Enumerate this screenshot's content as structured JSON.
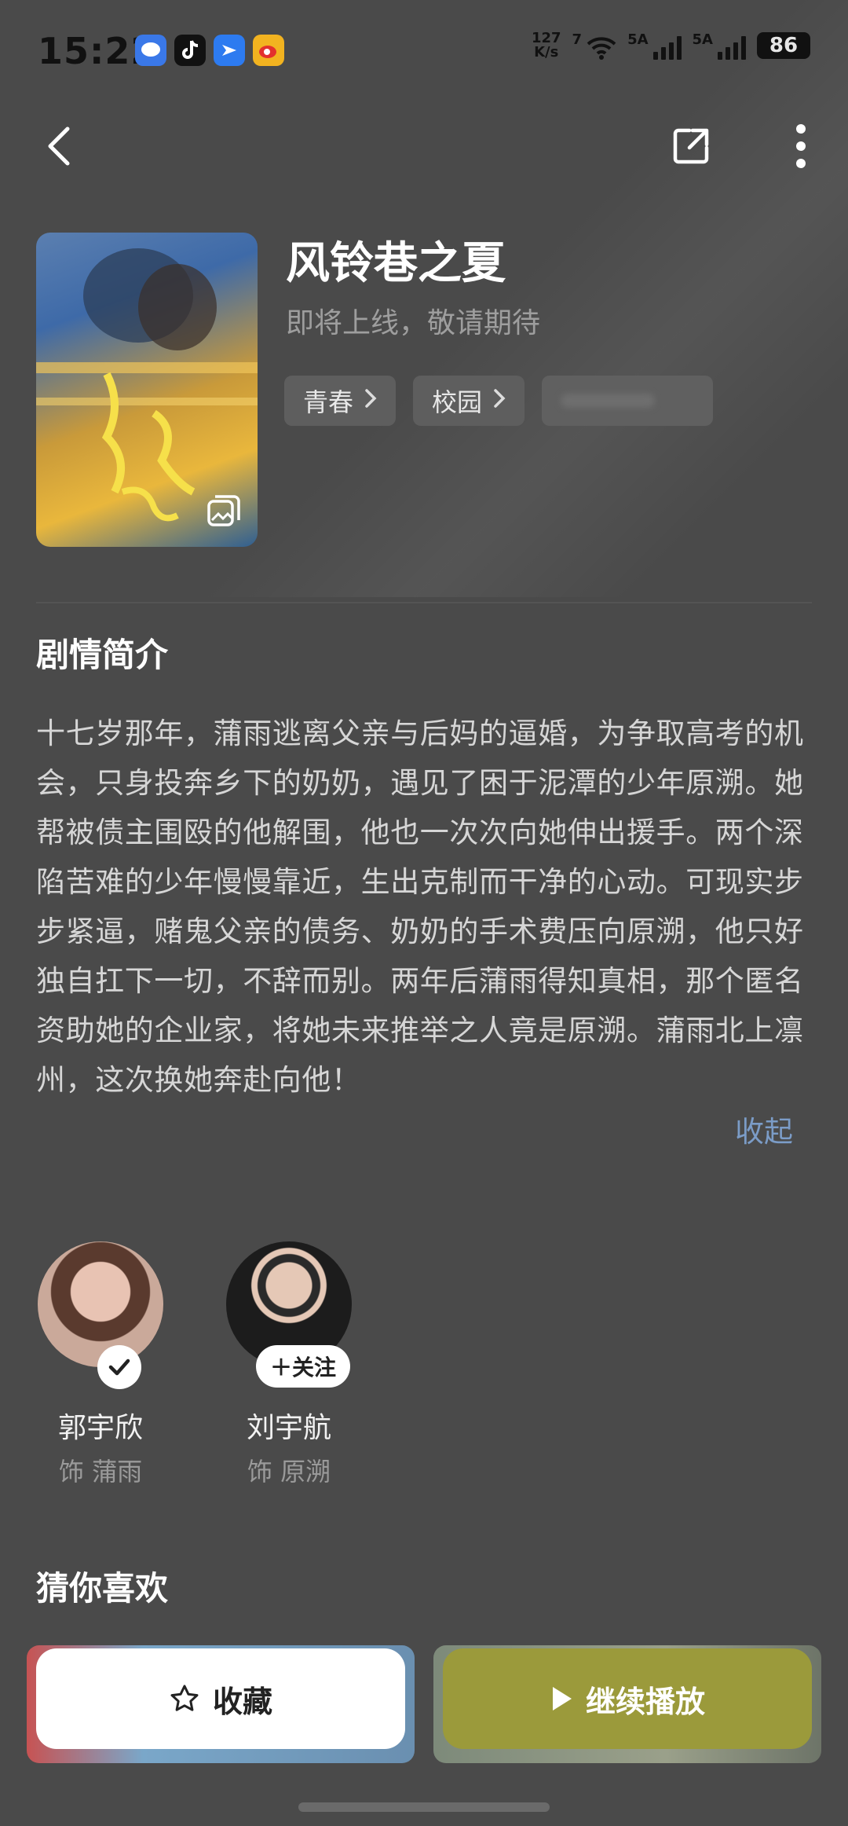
{
  "status_bar": {
    "time": "15:22",
    "net_speed_value": "127",
    "net_speed_unit": "K/s",
    "wifi_label": "7",
    "signal1_label": "5A",
    "signal2_label": "5A",
    "battery": "86",
    "app_icons": [
      "message-icon",
      "tiktok-icon",
      "feishu-icon",
      "weibo-icon"
    ]
  },
  "nav": {
    "back_icon": "chevron-left-icon",
    "share_icon": "share-icon",
    "more_icon": "more-vertical-icon"
  },
  "header": {
    "title": "风铃巷之夏",
    "subtitle": "即将上线，敬请期待",
    "tags": [
      {
        "label": "青春"
      },
      {
        "label": "校园"
      }
    ]
  },
  "synopsis": {
    "heading": "剧情简介",
    "text": "十七岁那年，蒲雨逃离父亲与后妈的逼婚，为争取高考的机会，只身投奔乡下的奶奶，遇见了困于泥潭的少年原溯。她帮被债主围殴的他解围，他也一次次向她伸出援手。两个深陷苦难的少年慢慢靠近，生出克制而干净的心动。可现实步步紧逼，赌鬼父亲的债务、奶奶的手术费压向原溯，他只好独自扛下一切，不辞而别。两年后蒲雨得知真相，那个匿名资助她的企业家，将她未来推举之人竟是原溯。蒲雨北上凛州，这次换她奔赴向他！",
    "collapse_label": "收起"
  },
  "cast": [
    {
      "name": "郭宇欣",
      "role": "饰 蒲雨",
      "badge": "check"
    },
    {
      "name": "刘宇航",
      "role": "饰 原溯",
      "badge": "＋关注"
    }
  ],
  "recommend": {
    "heading": "猜你喜欢"
  },
  "actions": {
    "favorite_label": "收藏",
    "play_label": "继续播放"
  },
  "colors": {
    "background": "#4a4a4a",
    "play_button": "#9b9a3b",
    "link": "#7b9cc7"
  }
}
